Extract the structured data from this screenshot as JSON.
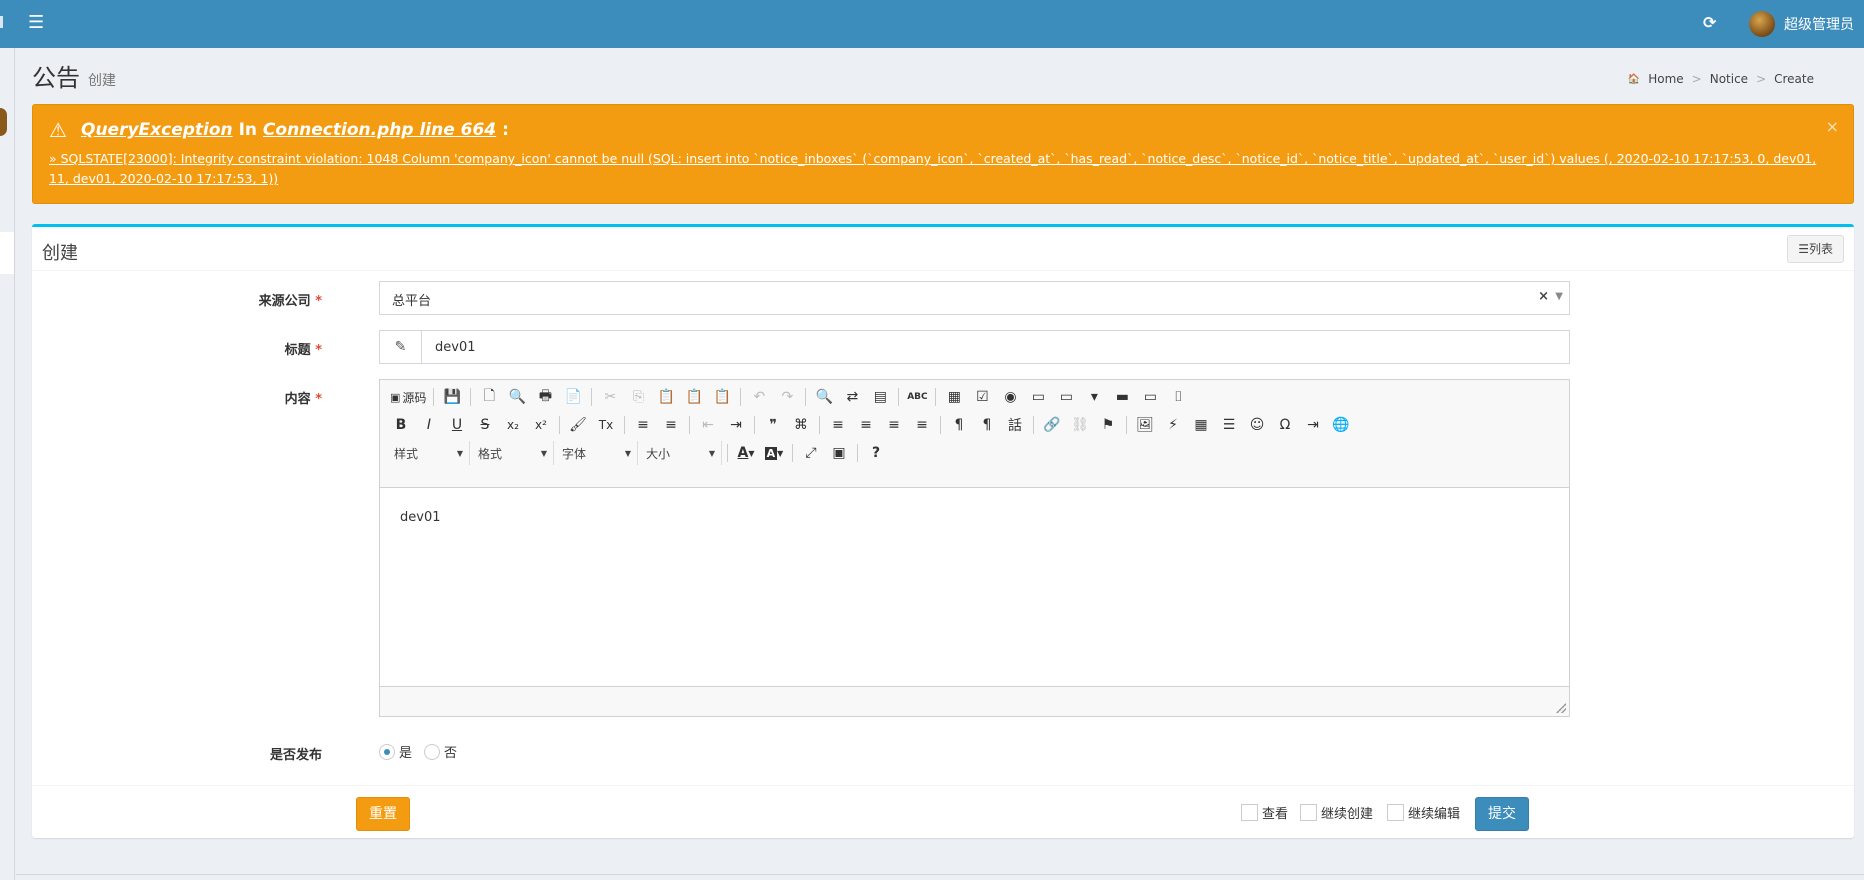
{
  "header": {
    "menu_icon": "☰",
    "refresh_icon": "⟳",
    "user_name": "超级管理员"
  },
  "page": {
    "title": "公告",
    "subtitle": "创建"
  },
  "breadcrumb": {
    "home_icon": "🏠",
    "items": [
      "Home",
      "Notice",
      "Create"
    ],
    "separator": ">"
  },
  "alert": {
    "icon": "⚠",
    "exception": "QueryException",
    "in_text": "In",
    "file": "Connection.php line 664",
    "colon": ":",
    "close": "×",
    "detail": "» SQLSTATE[23000]: Integrity constraint violation: 1048 Column 'company_icon' cannot be null (SQL: insert into `notice_inboxes` (`company_icon`, `created_at`, `has_read`, `notice_desc`, `notice_id`, `notice_title`, `updated_at`, `user_id`) values (, 2020-02-10 17:17:53, 0, dev01, 11, dev01, 2020-02-10 17:17:53, 1))"
  },
  "form": {
    "box_title": "创建",
    "list_button": "☰列表",
    "company_label": "来源公司",
    "company_value": "总平台",
    "title_label": "标题",
    "title_value": "dev01",
    "content_label": "内容",
    "content_value": "dev01",
    "publish_label": "是否发布",
    "publish_yes": "是",
    "publish_no": "否",
    "publish_selected": "是",
    "required_mark": "*",
    "reset_button": "重置",
    "submit_button": "提交",
    "check_view": "查看",
    "check_continue_create": "继续创建",
    "check_continue_edit": "继续编辑"
  },
  "editor": {
    "source_label": "源码",
    "combos": [
      "样式",
      "格式",
      "字体",
      "大小"
    ],
    "row1": [
      "▣",
      "💾",
      "🗋",
      "🔍",
      "🖶",
      "📄",
      "✂",
      "⎘",
      "📋",
      "📋",
      "📋",
      "↶",
      "↷",
      "🔍",
      "⇄",
      "▤",
      "ABC",
      "▦",
      "☑",
      "◉",
      "▭",
      "▭",
      "▾",
      "▬",
      "▭",
      "⌷"
    ],
    "row2": [
      "B",
      "I",
      "U",
      "S",
      "x₂",
      "x²",
      "🖌",
      "Tx",
      "≡",
      "≡",
      "⇤",
      "⇥",
      "❞",
      "⌘",
      "≡",
      "≡",
      "≡",
      "≡",
      "¶",
      "¶",
      "話",
      "🔗",
      "⛓",
      "⚑",
      "🖼",
      "⚡",
      "▦",
      "☰",
      "☺",
      "Ω",
      "⇥",
      "🌐"
    ],
    "row3": [
      "A",
      "A",
      "⤢",
      "▣",
      "?"
    ]
  },
  "colors": {
    "header": "#3c8dbc",
    "warning": "#f39c12",
    "primary": "#3c8dbc",
    "box_border": "#00c0ef",
    "required": "#dd4b39"
  }
}
